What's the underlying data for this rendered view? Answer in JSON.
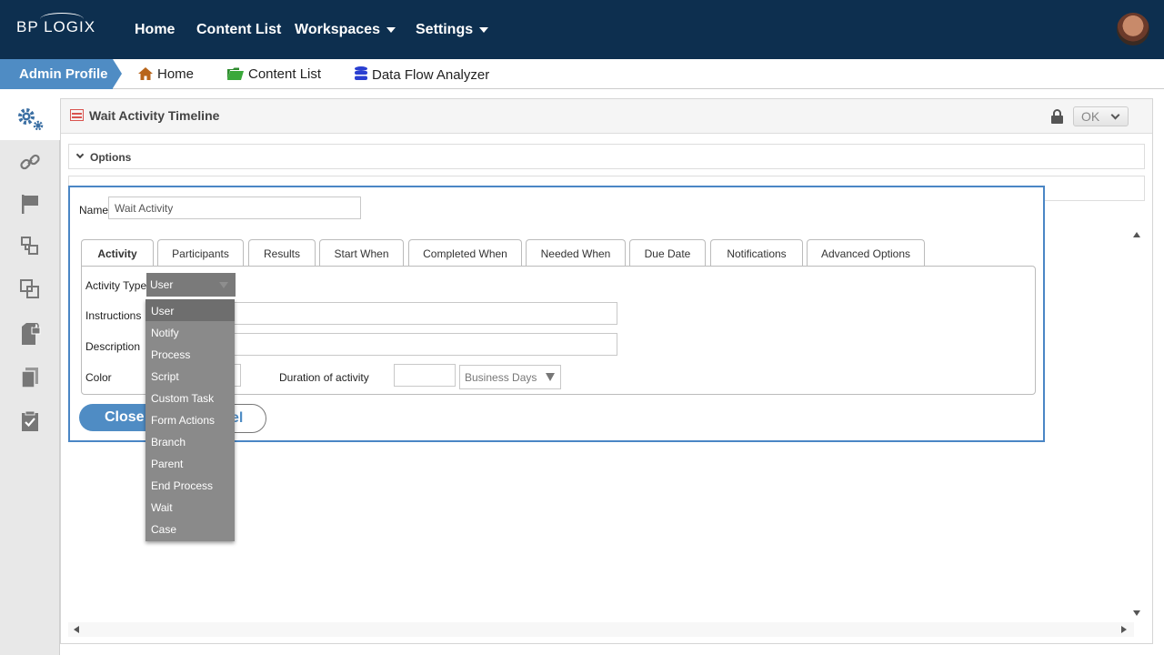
{
  "topbar": {
    "logo": "BP LOGIX",
    "nav": [
      {
        "label": "Home"
      },
      {
        "label": "Content List"
      },
      {
        "label": "Workspaces"
      },
      {
        "label": "Settings"
      }
    ]
  },
  "breadcrumb": {
    "profile": "Admin Profile",
    "items": [
      {
        "label": "Home",
        "icon": "home-icon"
      },
      {
        "label": "Content List",
        "icon": "folder-icon"
      },
      {
        "label": "Data Flow Analyzer",
        "icon": "database-icon"
      }
    ]
  },
  "sidebar": {
    "icons": [
      "gears-icon",
      "link-icon",
      "flag-icon",
      "workflow-icon",
      "copy-layers-icon",
      "locked-document-icon",
      "documents-icon",
      "checklist-icon"
    ]
  },
  "panel": {
    "title": "Wait Activity Timeline",
    "ok_label": "OK",
    "options_label": "Options"
  },
  "dialog": {
    "name_label": "Name",
    "name_value": "Wait Activity",
    "tabs": [
      {
        "label": "Activity"
      },
      {
        "label": "Participants"
      },
      {
        "label": "Results"
      },
      {
        "label": "Start When"
      },
      {
        "label": "Completed When"
      },
      {
        "label": "Needed When"
      },
      {
        "label": "Due Date"
      },
      {
        "label": "Notifications"
      },
      {
        "label": "Advanced Options"
      }
    ],
    "activity_type_label": "Activity Type",
    "activity_type_value": "User",
    "instructions_label": "Instructions",
    "description_label": "Description",
    "color_label": "Color",
    "duration_label": "Duration of activity",
    "duration_unit": "Business Days",
    "close_label": "Close",
    "cancel_label": "el"
  },
  "dropdown": {
    "selected": "User",
    "options": [
      "User",
      "Notify",
      "Process",
      "Script",
      "Custom Task",
      "Form Actions",
      "Branch",
      "Parent",
      "End Process",
      "Wait",
      "Case"
    ]
  },
  "colors": {
    "navbar": "#0d2f4f",
    "accent": "#4f8cc4",
    "dropdown": "#8a8a8a"
  }
}
